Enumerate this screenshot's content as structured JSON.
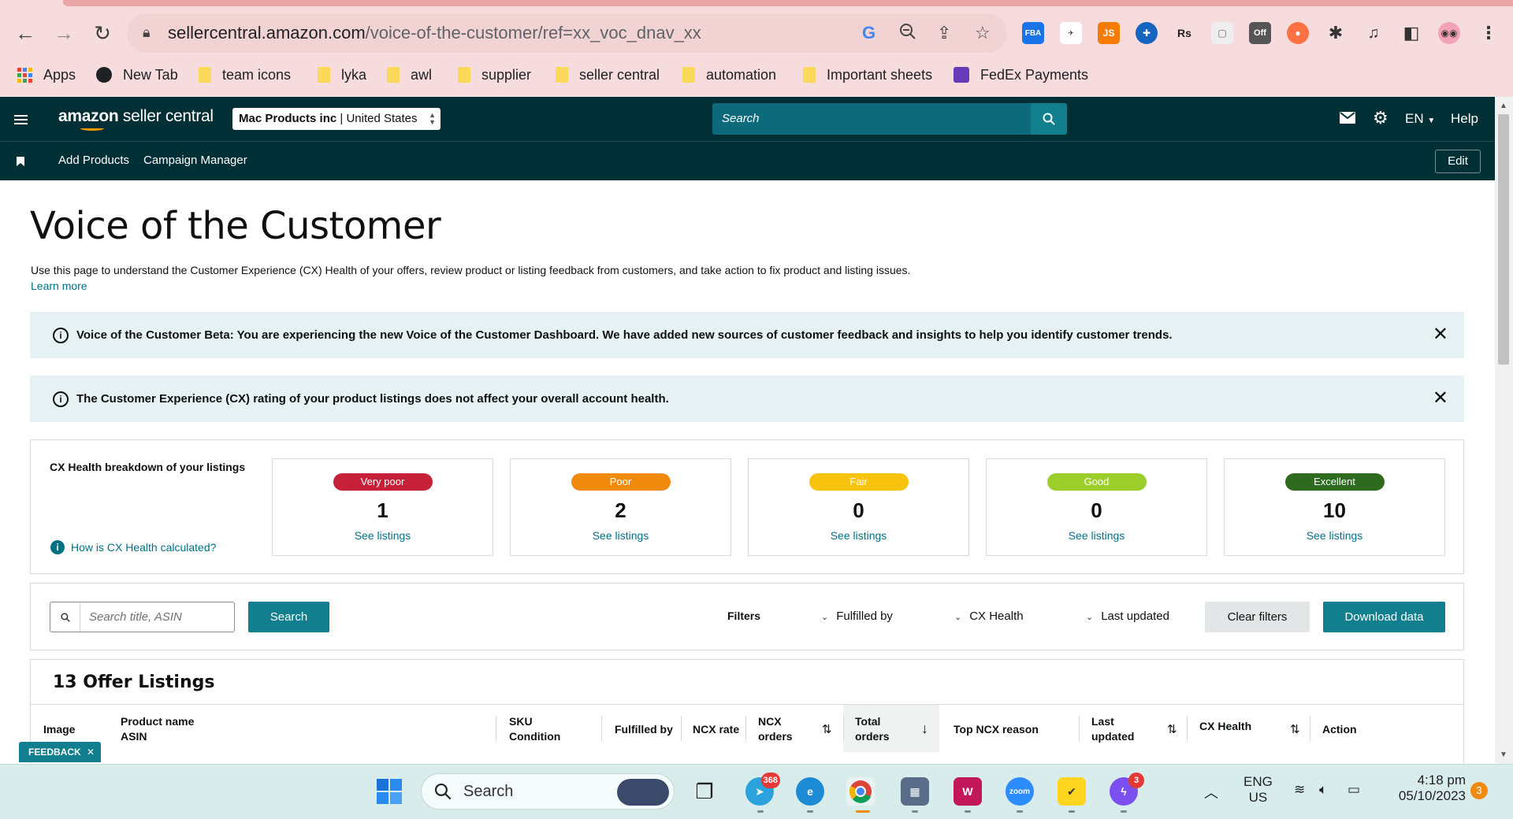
{
  "browser": {
    "url_domain": "sellercentral.amazon.com",
    "url_path": "/voice-of-the-customer/ref=xx_voc_dnav_xx",
    "extensions": {
      "fba": "FBA",
      "js": "JS",
      "rs": "Rs",
      "off": "Off"
    },
    "bookmarks": [
      {
        "label": "Apps",
        "icon": "apps-grid-icon"
      },
      {
        "label": "New Tab",
        "icon": "globe-icon"
      },
      {
        "label": "team icons",
        "icon": "folder-icon"
      },
      {
        "label": "lyka",
        "icon": "folder-icon"
      },
      {
        "label": "awl",
        "icon": "folder-icon"
      },
      {
        "label": "supplier",
        "icon": "folder-icon"
      },
      {
        "label": "seller central",
        "icon": "folder-icon"
      },
      {
        "label": "automation",
        "icon": "folder-icon"
      },
      {
        "label": "Important sheets",
        "icon": "folder-icon"
      },
      {
        "label": "FedEx Payments",
        "icon": "sheets-icon"
      }
    ]
  },
  "header": {
    "logo_bold": "amazon",
    "logo_rest": " seller central",
    "account_name": "Mac Products inc",
    "account_region": "United States",
    "search_placeholder": "Search",
    "language": "EN",
    "help": "Help"
  },
  "nav": {
    "links": [
      "Add Products",
      "Campaign Manager"
    ],
    "edit": "Edit"
  },
  "page": {
    "title": "Voice of the Customer",
    "description": "Use this page to understand the Customer Experience (CX) Health of your offers, review product or listing feedback from customers, and take action to fix product and listing issues.",
    "learn_more": "Learn more"
  },
  "banners": [
    {
      "text": "Voice of the Customer Beta: You are experiencing the new Voice of the Customer Dashboard. We have added new sources of customer feedback and insights to help you identify customer trends."
    },
    {
      "text": "The Customer Experience (CX) rating of your product listings does not affect your overall account health."
    }
  ],
  "breakdown": {
    "title": "CX Health breakdown of your listings",
    "help_link": "How is CX Health calculated?",
    "cards": [
      {
        "label": "Very poor",
        "count": "1",
        "link": "See listings",
        "color": "#c7213a"
      },
      {
        "label": "Poor",
        "count": "2",
        "link": "See listings",
        "color": "#f08b10"
      },
      {
        "label": "Fair",
        "count": "0",
        "link": "See listings",
        "color": "#f8c30c"
      },
      {
        "label": "Good",
        "count": "0",
        "link": "See listings",
        "color": "#9ccf2b"
      },
      {
        "label": "Excellent",
        "count": "10",
        "link": "See listings",
        "color": "#2f6b1f"
      }
    ]
  },
  "filters": {
    "search_placeholder": "Search title, ASIN",
    "search_button": "Search",
    "filters_label": "Filters",
    "dropdowns": [
      "Fulfilled by",
      "CX Health",
      "Last updated"
    ],
    "clear": "Clear filters",
    "download": "Download data"
  },
  "listings": {
    "title": "13 Offer Listings",
    "columns": {
      "image": "Image",
      "product_name": "Product name",
      "asin": "ASIN",
      "sku": "SKU",
      "condition": "Condition",
      "fulfilled_by": "Fulfilled by",
      "ncx_rate": "NCX rate",
      "ncx": "NCX",
      "orders": "orders",
      "total": "Total",
      "total_orders": "orders",
      "top_ncx_reason": "Top NCX reason",
      "last": "Last",
      "updated": "updated",
      "cx_health": "CX Health",
      "action": "Action"
    }
  },
  "feedback": "FEEDBACK",
  "taskbar": {
    "search": "Search",
    "telegram_badge": "368",
    "messenger_badge": "3",
    "lang_top": "ENG",
    "lang_bottom": "US",
    "time": "4:18 pm",
    "date": "05/10/2023",
    "notifications": "3"
  }
}
